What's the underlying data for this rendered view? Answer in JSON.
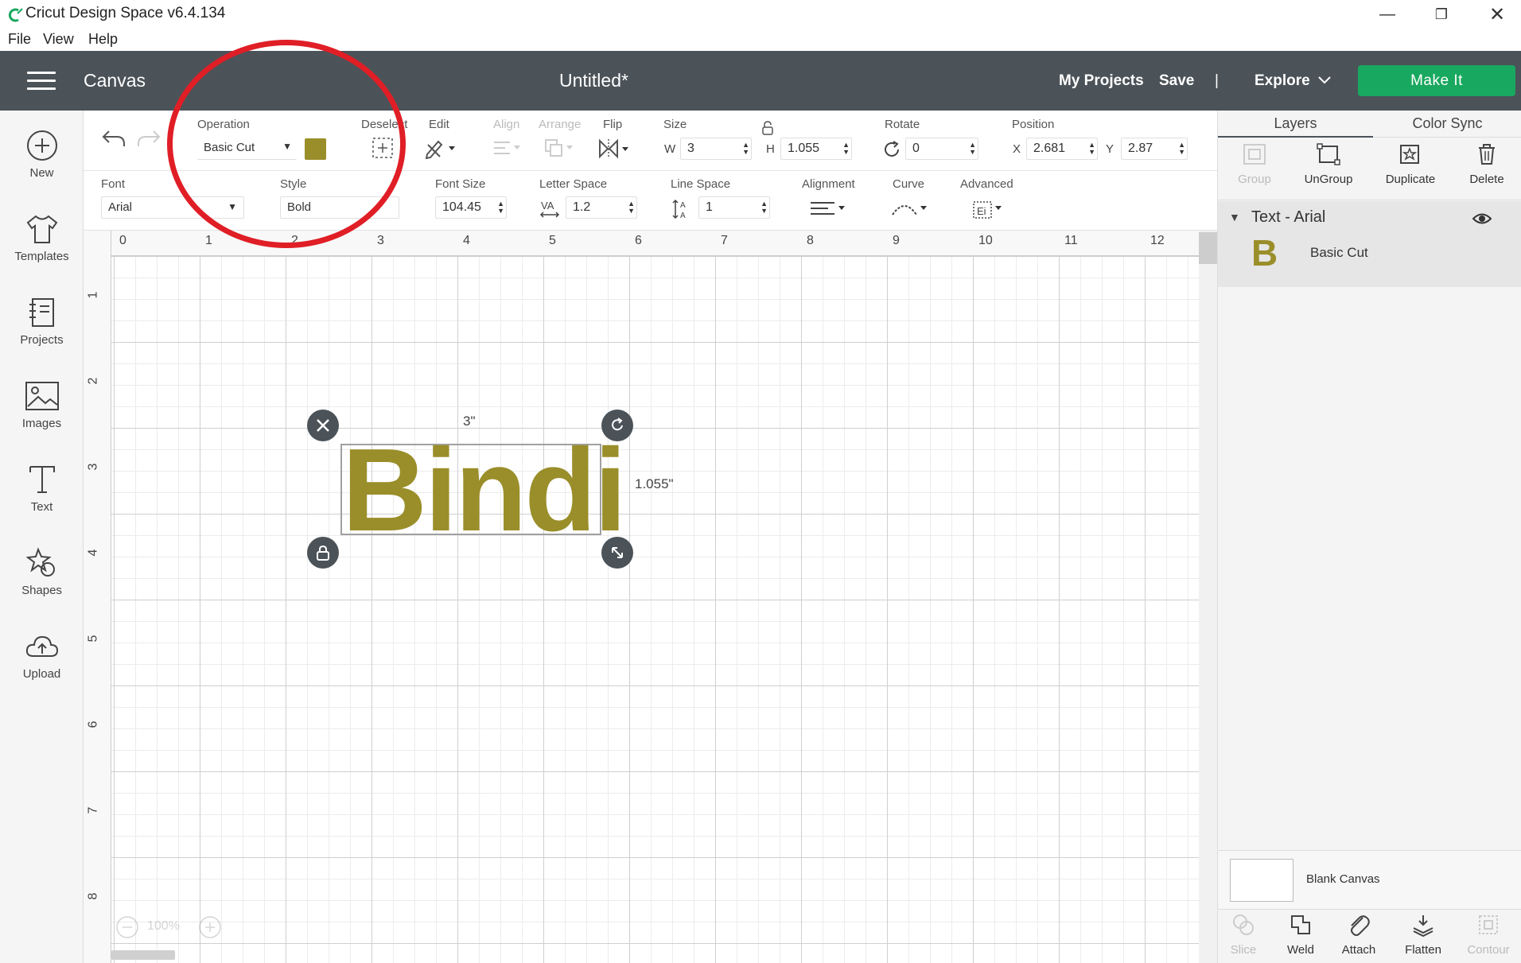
{
  "app": {
    "title": "Cricut Design Space  v6.4.134",
    "window_controls": [
      "minimize",
      "restore",
      "close"
    ]
  },
  "menu": [
    "File",
    "View",
    "Help"
  ],
  "header": {
    "section": "Canvas",
    "document_title": "Untitled*",
    "my_projects": "My Projects",
    "save": "Save",
    "divider": "|",
    "explore": "Explore",
    "make_it": "Make It",
    "make_it_color": "#19a85f",
    "bar_color": "#4b5359"
  },
  "sidebar": [
    {
      "label": "New",
      "icon": "plus-circle-icon"
    },
    {
      "label": "Templates",
      "icon": "tshirt-icon"
    },
    {
      "label": "Projects",
      "icon": "notebook-icon"
    },
    {
      "label": "Images",
      "icon": "image-icon"
    },
    {
      "label": "Text",
      "icon": "text-t-icon"
    },
    {
      "label": "Shapes",
      "icon": "shapes-icon"
    },
    {
      "label": "Upload",
      "icon": "cloud-upload-icon"
    }
  ],
  "toolbar": {
    "operation_label": "Operation",
    "operation_value": "Basic Cut",
    "color_swatch": "#9a8e2a",
    "deselect_label": "Deselect",
    "edit_label": "Edit",
    "align_label": "Align",
    "arrange_label": "Arrange",
    "flip_label": "Flip",
    "size_label": "Size",
    "w_label": "W",
    "w_value": "3",
    "h_label": "H",
    "h_value": "1.055",
    "rotate_label": "Rotate",
    "rotate_value": "0",
    "position_label": "Position",
    "x_label": "X",
    "x_value": "2.681",
    "y_label": "Y",
    "y_value": "2.87",
    "font_label": "Font",
    "font_value": "Arial",
    "style_label": "Style",
    "style_value": "Bold",
    "font_size_label": "Font Size",
    "font_size_value": "104.45",
    "letter_space_label": "Letter Space",
    "letter_space_value": "1.2",
    "line_space_label": "Line Space",
    "line_space_value": "1",
    "alignment_label": "Alignment",
    "curve_label": "Curve",
    "advanced_label": "Advanced"
  },
  "ruler": {
    "horizontal": [
      "0",
      "1",
      "2",
      "3",
      "4",
      "5",
      "6",
      "7",
      "8",
      "9",
      "10",
      "11",
      "12"
    ],
    "vertical": [
      "1",
      "2",
      "3",
      "4",
      "5",
      "6",
      "7",
      "8"
    ]
  },
  "canvas": {
    "text": "Bindi",
    "text_color": "#9a8e2a",
    "width_label": "3\"",
    "height_label": "1.055\"",
    "zoom": "100%"
  },
  "layers_panel": {
    "tabs": [
      "Layers",
      "Color Sync"
    ],
    "actions": [
      {
        "label": "Group",
        "enabled": false
      },
      {
        "label": "UnGroup",
        "enabled": true
      },
      {
        "label": "Duplicate",
        "enabled": true
      },
      {
        "label": "Delete",
        "enabled": true
      }
    ],
    "group_name": "Text - Arial",
    "layer_letter": "B",
    "layer_name": "Basic Cut",
    "blank_canvas": "Blank Canvas",
    "bottom_tools": [
      {
        "label": "Slice",
        "enabled": false
      },
      {
        "label": "Weld",
        "enabled": true
      },
      {
        "label": "Attach",
        "enabled": true
      },
      {
        "label": "Flatten",
        "enabled": true
      },
      {
        "label": "Contour",
        "enabled": false
      }
    ]
  },
  "annotation": {
    "circle_color": "#e01e26"
  }
}
